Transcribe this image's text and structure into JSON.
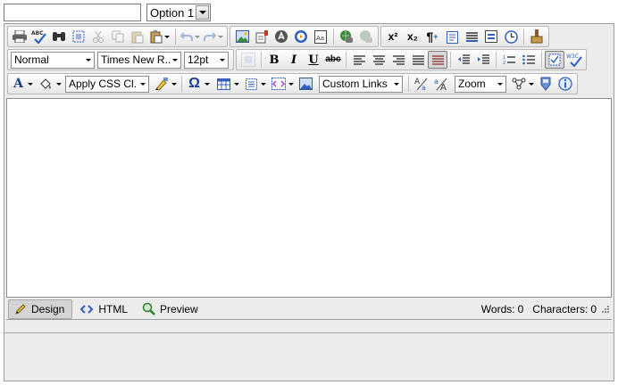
{
  "top": {
    "input_value": "",
    "select_value": "Option 1"
  },
  "toolbar": {
    "format_value": "Normal",
    "font_value": "Times New R...",
    "size_value": "12pt",
    "css_class_value": "Apply CSS Cl...",
    "links_value": "Custom Links",
    "zoom_value": "Zoom"
  },
  "glyphs": {
    "superscript": "x²",
    "subscript": "x₂",
    "bold": "B",
    "italic": "I",
    "underline": "U",
    "strike": "abc",
    "font_color": "A",
    "omega": "Ω",
    "spell_abc": "ABC",
    "w3c": "W3C",
    "paragraph": "¶"
  },
  "mode_tabs": {
    "design": "Design",
    "html": "HTML",
    "preview": "Preview"
  },
  "stats": {
    "words_label": "Words:",
    "words_value": "0",
    "chars_label": "Characters:",
    "chars_value": "0"
  },
  "colors": {
    "toolbar_bg": "#ececec",
    "border": "#9e9e9e",
    "accent_blue": "#2f5fbf"
  }
}
